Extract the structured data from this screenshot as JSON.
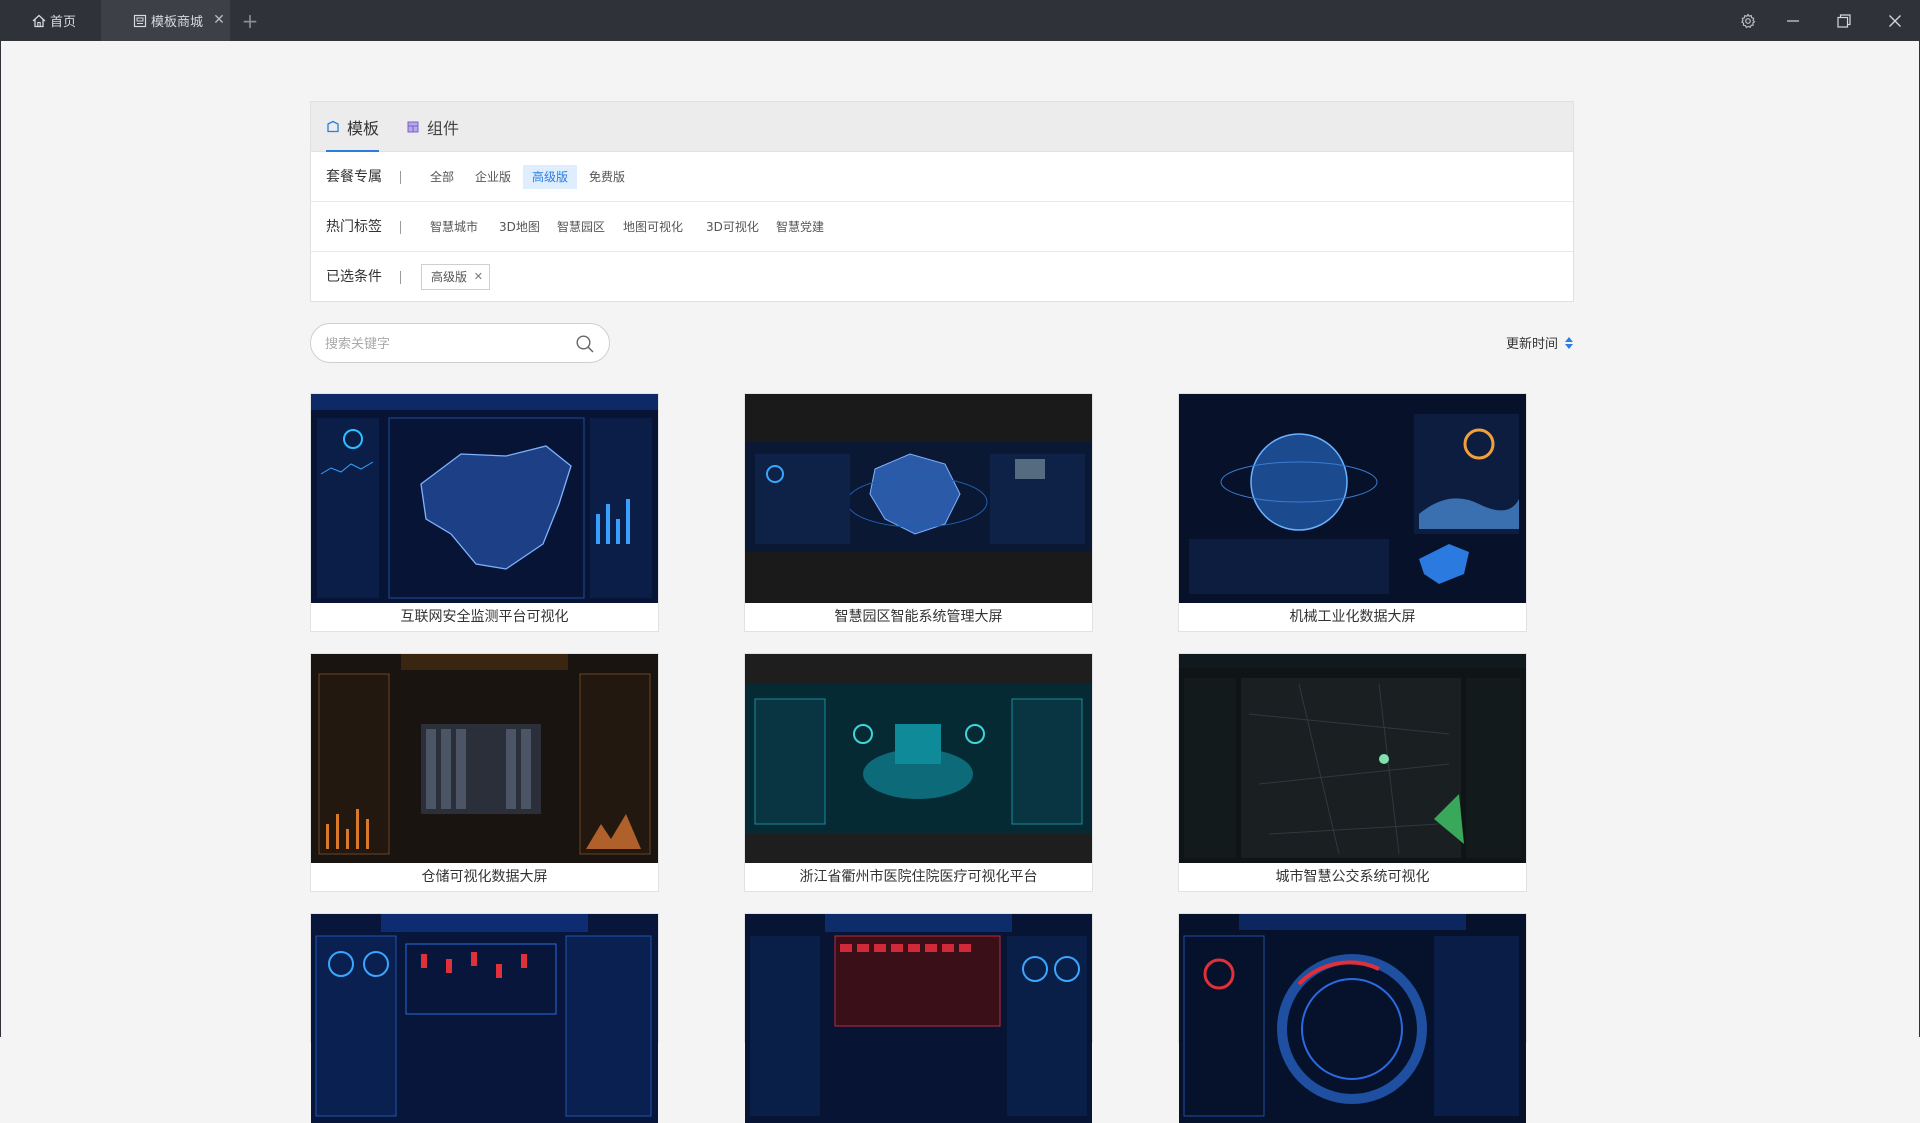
{
  "window": {
    "tabs": [
      {
        "label": "首页",
        "icon": "home-icon"
      },
      {
        "label": "模板商城",
        "icon": "store-icon"
      }
    ],
    "controls": [
      "gear-icon",
      "minimize-icon",
      "restore-icon",
      "close-icon"
    ]
  },
  "filter": {
    "tabs": [
      {
        "label": "模板",
        "icon": "template-icon",
        "active": true
      },
      {
        "label": "组件",
        "icon": "component-icon",
        "active": false
      }
    ],
    "package": {
      "label": "套餐专属",
      "options": [
        "全部",
        "企业版",
        "高级版",
        "免费版"
      ],
      "selected": "高级版"
    },
    "tags": {
      "label": "热门标签",
      "options": [
        "智慧城市",
        "3D地图",
        "智慧园区",
        "地图可视化",
        "3D可视化",
        "智慧党建"
      ]
    },
    "chosen": {
      "label": "已选条件",
      "chips": [
        "高级版"
      ]
    }
  },
  "search": {
    "placeholder": "搜索关键字",
    "value": ""
  },
  "sort": {
    "label": "更新时间"
  },
  "colors": {
    "accent": "#2b7de0",
    "titlebar": "#2f3238",
    "dashboard_bg": "#0a1530"
  },
  "cards": [
    {
      "title": "互联网安全监测平台可视化",
      "theme": "blue-map"
    },
    {
      "title": "智慧园区智能系统管理大屏",
      "theme": "dark-map"
    },
    {
      "title": "机械工业化数据大屏",
      "theme": "globe"
    },
    {
      "title": "仓储可视化数据大屏",
      "theme": "orange-grid"
    },
    {
      "title": "浙江省衢州市医院住院医疗可视化平台",
      "theme": "teal-hospital"
    },
    {
      "title": "城市智慧公交系统可视化",
      "theme": "dark-city"
    },
    {
      "title": "",
      "theme": "blue-red"
    },
    {
      "title": "",
      "theme": "red-hospital"
    },
    {
      "title": "",
      "theme": "radar"
    }
  ]
}
